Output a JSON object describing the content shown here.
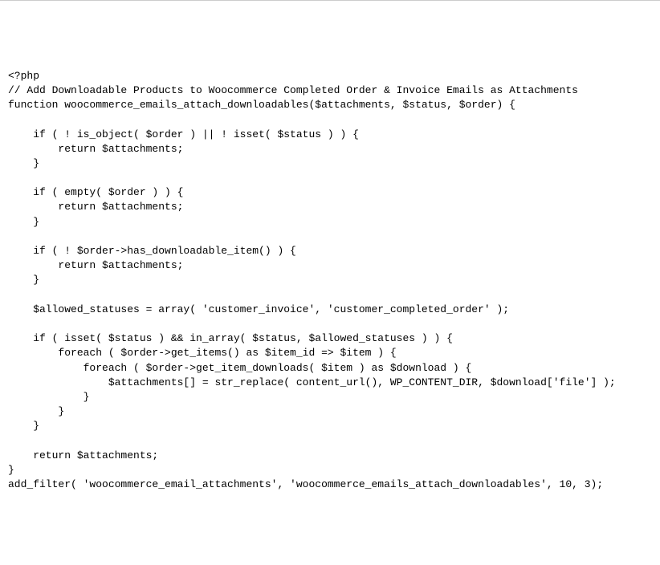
{
  "code": {
    "line01": "<?php",
    "line02": "// Add Downloadable Products to Woocommerce Completed Order & Invoice Emails as Attachments",
    "line03": "function woocommerce_emails_attach_downloadables($attachments, $status, $order) {",
    "line04": "",
    "line05": "    if ( ! is_object( $order ) || ! isset( $status ) ) {",
    "line06": "        return $attachments;",
    "line07": "    }",
    "line08": "",
    "line09": "    if ( empty( $order ) ) {",
    "line10": "        return $attachments;",
    "line11": "    }",
    "line12": "",
    "line13": "    if ( ! $order->has_downloadable_item() ) {",
    "line14": "        return $attachments;",
    "line15": "    }",
    "line16": "",
    "line17": "    $allowed_statuses = array( 'customer_invoice', 'customer_completed_order' );",
    "line18": "",
    "line19": "    if ( isset( $status ) && in_array( $status, $allowed_statuses ) ) {",
    "line20": "        foreach ( $order->get_items() as $item_id => $item ) {",
    "line21": "            foreach ( $order->get_item_downloads( $item ) as $download ) {",
    "line22": "                $attachments[] = str_replace( content_url(), WP_CONTENT_DIR, $download['file'] );",
    "line23": "            }",
    "line24": "        }",
    "line25": "    }",
    "line26": "",
    "line27": "    return $attachments;",
    "line28": "}",
    "line29": "add_filter( 'woocommerce_email_attachments', 'woocommerce_emails_attach_downloadables', 10, 3);"
  }
}
